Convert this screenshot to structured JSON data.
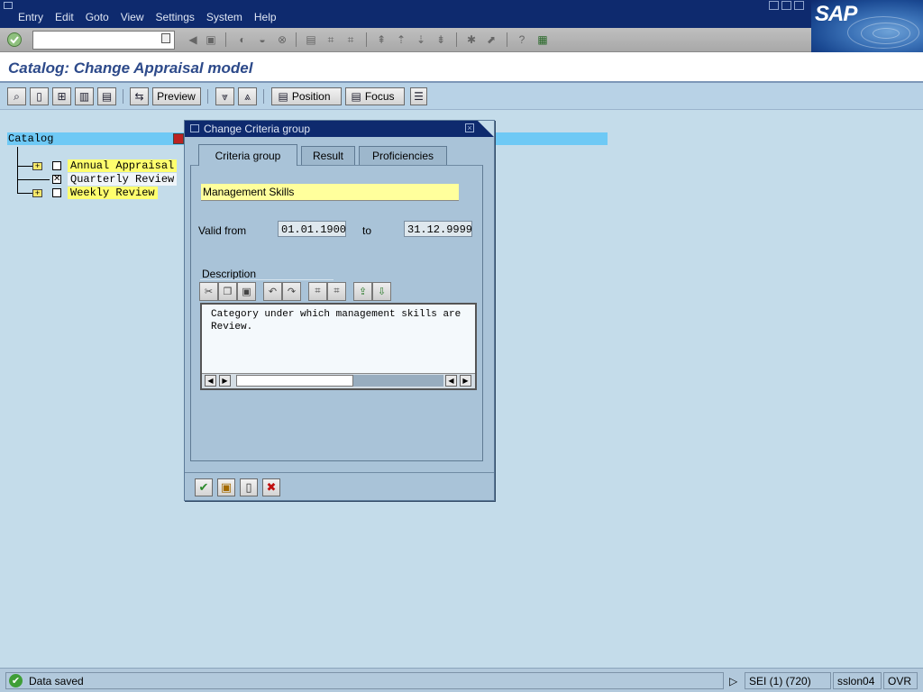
{
  "menu": {
    "items": [
      "Entry",
      "Edit",
      "Goto",
      "View",
      "Settings",
      "System",
      "Help"
    ],
    "logo": "SAP"
  },
  "toolbar": {
    "command_value": "",
    "icons": [
      "back-arrow-icon",
      "save-icon",
      "back-icon",
      "exit-icon",
      "cancel-icon",
      "print-icon",
      "find-icon",
      "find-next-icon",
      "first-page-icon",
      "previous-page-icon",
      "next-page-icon",
      "last-page-icon",
      "new-session-icon",
      "shortcut-icon",
      "help-icon",
      "layout-icon"
    ]
  },
  "page": {
    "title": "Catalog: Change Appraisal model"
  },
  "app_toolbar": {
    "preview_label": "Preview",
    "position_label": "Position",
    "focus_label": "Focus"
  },
  "tree": {
    "header": "Catalog",
    "nodes": [
      {
        "label": "Annual Appraisal",
        "checked": false,
        "expandable": true
      },
      {
        "label": "Quarterly Review",
        "checked": true,
        "expandable": false
      },
      {
        "label": "Weekly Review",
        "checked": false,
        "expandable": true
      }
    ]
  },
  "dialog": {
    "title": "Change Criteria group",
    "tabs": [
      "Criteria group",
      "Result",
      "Proficiencies"
    ],
    "name_value": "Management Skills",
    "valid_from_label": "Valid from",
    "valid_from_value": "01.01.1900",
    "to_label": "to",
    "valid_to_value": "31.12.9999",
    "description_label": "Description",
    "description_text": "Category under which management skills are\nReview."
  },
  "status": {
    "message": "Data saved",
    "session": "SEI (1) (720)",
    "server": "sslon04",
    "mode": "OVR"
  },
  "colors": {
    "menubar": "#0e2a6e",
    "background": "#c4dcea",
    "title_text": "#2d4a8a",
    "tree_header": "#6ec9f5",
    "highlight": "#ffff6e"
  }
}
